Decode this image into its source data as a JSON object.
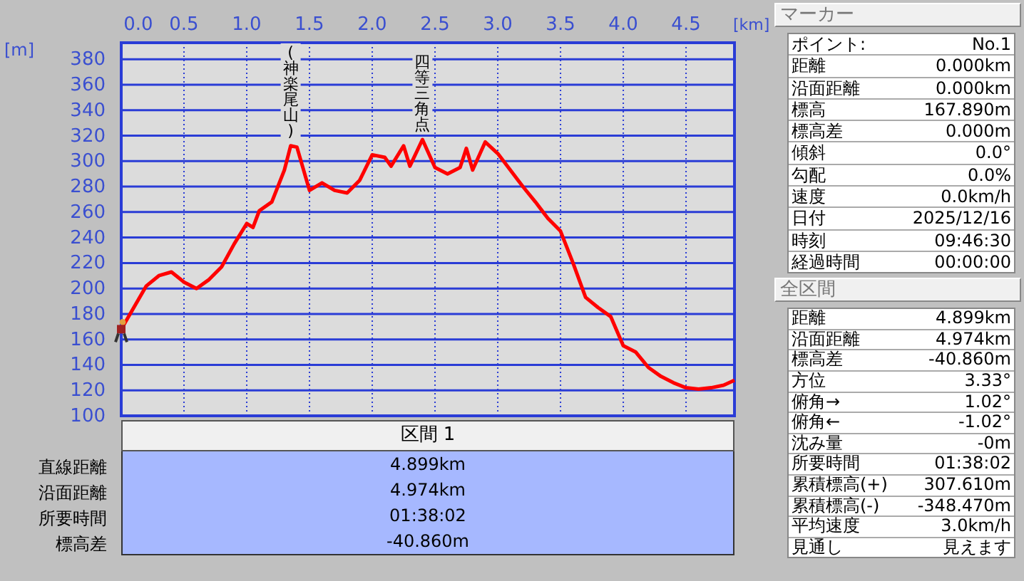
{
  "chart_data": {
    "type": "line",
    "xlabel": "[km]",
    "ylabel": "[m]",
    "x": [
      0,
      0.1,
      0.2,
      0.3,
      0.4,
      0.5,
      0.6,
      0.7,
      0.8,
      0.9,
      1.0,
      1.05,
      1.1,
      1.2,
      1.3,
      1.35,
      1.4,
      1.5,
      1.6,
      1.7,
      1.8,
      1.9,
      2.0,
      2.1,
      2.15,
      2.25,
      2.3,
      2.4,
      2.5,
      2.6,
      2.7,
      2.75,
      2.8,
      2.9,
      3.0,
      3.1,
      3.2,
      3.3,
      3.4,
      3.5,
      3.6,
      3.7,
      3.8,
      3.9,
      4.0,
      4.1,
      4.2,
      4.3,
      4.4,
      4.5,
      4.6,
      4.7,
      4.8,
      4.886
    ],
    "series": [
      {
        "color": "#ff0000",
        "values": [
          168,
          185,
          202,
          210,
          213,
          205,
          200,
          207,
          217,
          235,
          251,
          248,
          261,
          268,
          293,
          312,
          311,
          277,
          283,
          277,
          275,
          285,
          305,
          303,
          296,
          312,
          296,
          317,
          295,
          290,
          295,
          310,
          293,
          315,
          306,
          293,
          280,
          268,
          255,
          245,
          220,
          193,
          185,
          178,
          155,
          150,
          138,
          131,
          126,
          122,
          121,
          122,
          124,
          128
        ]
      }
    ],
    "xlim": [
      0,
      4.886
    ],
    "ylim": [
      100,
      393
    ],
    "xticks": [
      {
        "value": 0,
        "label": "0.0"
      },
      {
        "value": 0.5,
        "label": "0.5"
      },
      {
        "value": 1,
        "label": "1.0"
      },
      {
        "value": 1.5,
        "label": "1.5"
      },
      {
        "value": 2,
        "label": "2.0"
      },
      {
        "value": 2.5,
        "label": "2.5"
      },
      {
        "value": 3,
        "label": "3.0"
      },
      {
        "value": 3.5,
        "label": "3.5"
      },
      {
        "value": 4,
        "label": "4.0"
      },
      {
        "value": 4.5,
        "label": "4.5"
      }
    ],
    "yticks": [
      100,
      120,
      140,
      160,
      180,
      200,
      220,
      240,
      260,
      280,
      300,
      320,
      340,
      360,
      380
    ],
    "grid": true,
    "annotations": [
      {
        "x": 1.35,
        "y": 312,
        "text": "(神楽尾山)"
      },
      {
        "x": 2.4,
        "y": 317,
        "text": "四等三角点"
      }
    ]
  },
  "section": {
    "title": "区間 1",
    "rows": [
      {
        "label": "直線距離",
        "value": "4.899km"
      },
      {
        "label": "沿面距離",
        "value": "4.974km"
      },
      {
        "label": "所要時間",
        "value": "01:38:02"
      },
      {
        "label": "標高差",
        "value": "-40.860m"
      }
    ]
  },
  "marker": {
    "title": "マーカー",
    "rows": [
      {
        "label": "ポイント:",
        "value": "No.1"
      },
      {
        "label": "距離",
        "value": "0.000km"
      },
      {
        "label": "沿面距離",
        "value": "0.000km"
      },
      {
        "label": "標高",
        "value": "167.890m"
      },
      {
        "label": "標高差",
        "value": "0.000m"
      },
      {
        "label": "傾斜",
        "value": "0.0°"
      },
      {
        "label": "勾配",
        "value": "0.0%"
      },
      {
        "label": "速度",
        "value": "0.0km/h"
      },
      {
        "label": "日付",
        "value": "2025/12/16"
      },
      {
        "label": "時刻",
        "value": "09:46:30"
      },
      {
        "label": "経過時間",
        "value": "00:00:00"
      }
    ]
  },
  "total": {
    "title": "全区間",
    "rows": [
      {
        "label": "距離",
        "value": "4.899km"
      },
      {
        "label": "沿面距離",
        "value": "4.974km"
      },
      {
        "label": "標高差",
        "value": "-40.860m"
      },
      {
        "label": "方位",
        "value": "3.33°"
      },
      {
        "label": "俯角→",
        "value": "1.02°"
      },
      {
        "label": "俯角←",
        "value": "-1.02°"
      },
      {
        "label": "沈み量",
        "value": "-0m"
      },
      {
        "label": "所要時間",
        "value": "01:38:02"
      },
      {
        "label": "累積標高(+)",
        "value": "307.610m"
      },
      {
        "label": "累積標高(-)",
        "value": "-348.470m"
      },
      {
        "label": "平均速度",
        "value": "3.0km/h"
      },
      {
        "label": "見通し",
        "value": "見えます"
      }
    ]
  }
}
